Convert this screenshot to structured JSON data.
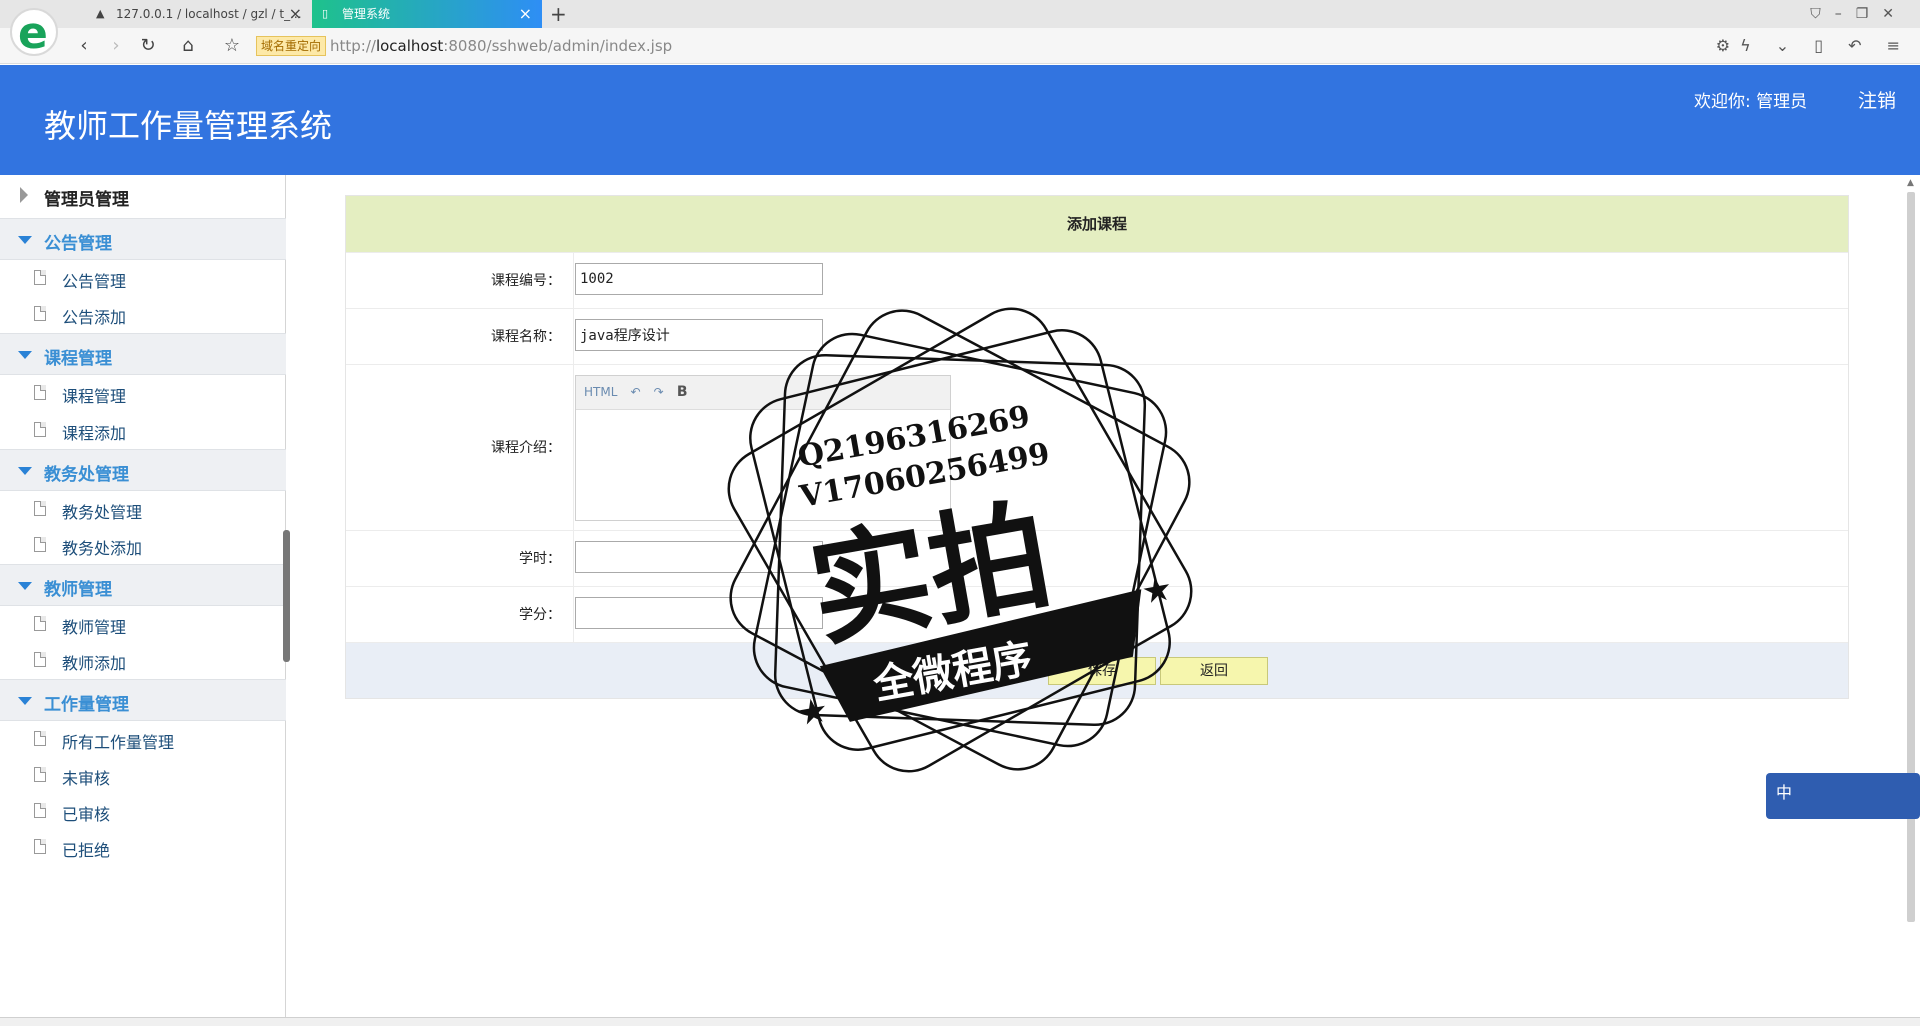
{
  "browser": {
    "tabs": [
      {
        "label": "127.0.0.1 / localhost / gzl / t_..."
      },
      {
        "label": "管理系统"
      }
    ],
    "dns_badge": "域名重定向",
    "url_prefix": "http://",
    "url_host": "localhost",
    "url_rest": ":8080/sshweb/admin/index.jsp"
  },
  "header": {
    "title": "教师工作量管理系统",
    "welcome": "欢迎你: 管理员",
    "logout": "注销"
  },
  "sidebar": {
    "top": "管理员管理",
    "groups": [
      {
        "label": "公告管理",
        "items": [
          "公告管理",
          "公告添加"
        ]
      },
      {
        "label": "课程管理",
        "items": [
          "课程管理",
          "课程添加"
        ]
      },
      {
        "label": "教务处管理",
        "items": [
          "教务处管理",
          "教务处添加"
        ]
      },
      {
        "label": "教师管理",
        "items": [
          "教师管理",
          "教师添加"
        ]
      },
      {
        "label": "工作量管理",
        "items": [
          "所有工作量管理",
          "未审核",
          "已审核",
          "已拒绝"
        ]
      }
    ]
  },
  "form": {
    "title": "添加课程",
    "fields": {
      "code": {
        "label": "课程编号：",
        "value": "1002"
      },
      "name": {
        "label": "课程名称：",
        "value": "java程序设计"
      },
      "intro": {
        "label": "课程介绍："
      },
      "hours": {
        "label": "学时：",
        "value": ""
      },
      "credit": {
        "label": "学分：",
        "value": ""
      }
    },
    "editor_toolbar": {
      "html": "HTML",
      "bold": "B"
    },
    "save": "保存",
    "back": "返回"
  },
  "watermark": {
    "line1": "Q2196316269",
    "line2": "V17060256499",
    "big": "实拍",
    "ribbon": "全微程序"
  },
  "widget": {
    "label": "中"
  }
}
